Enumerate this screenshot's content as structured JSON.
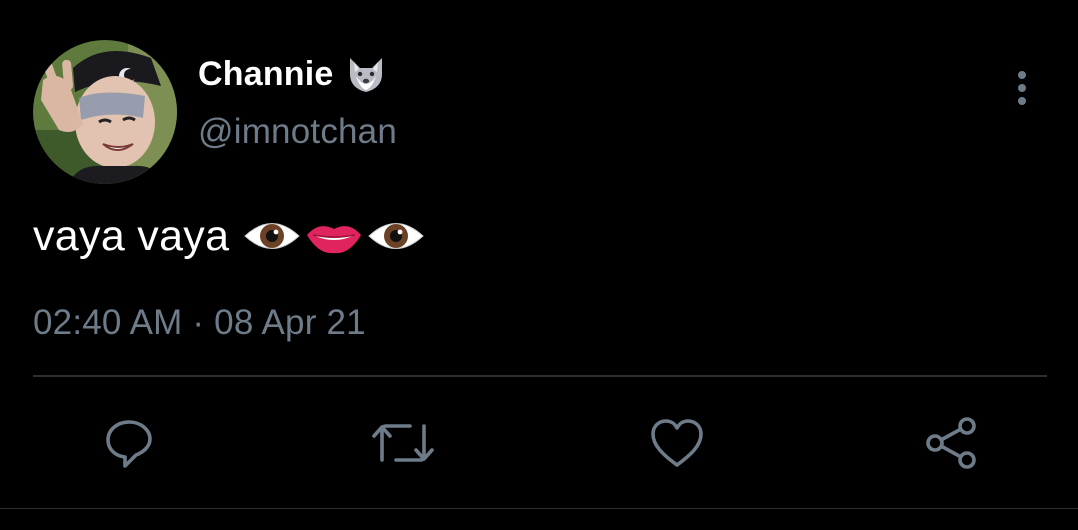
{
  "tweet": {
    "display_name": "Channie",
    "display_name_emoji": "wolf-face-emoji",
    "handle": "@imnotchan",
    "text": "vaya vaya",
    "text_emojis": [
      "eye-emoji",
      "lips-emoji",
      "eye-emoji"
    ],
    "timestamp": "02:40 AM · 08 Apr 21"
  },
  "actions": [
    {
      "name": "reply",
      "icon": "reply-icon"
    },
    {
      "name": "retweet",
      "icon": "retweet-icon"
    },
    {
      "name": "like",
      "icon": "heart-icon"
    },
    {
      "name": "share",
      "icon": "share-icon"
    }
  ],
  "colors": {
    "background": "#000000",
    "primary_text": "#ffffff",
    "secondary_text": "#6e7b88",
    "divider": "#2b2f33"
  }
}
